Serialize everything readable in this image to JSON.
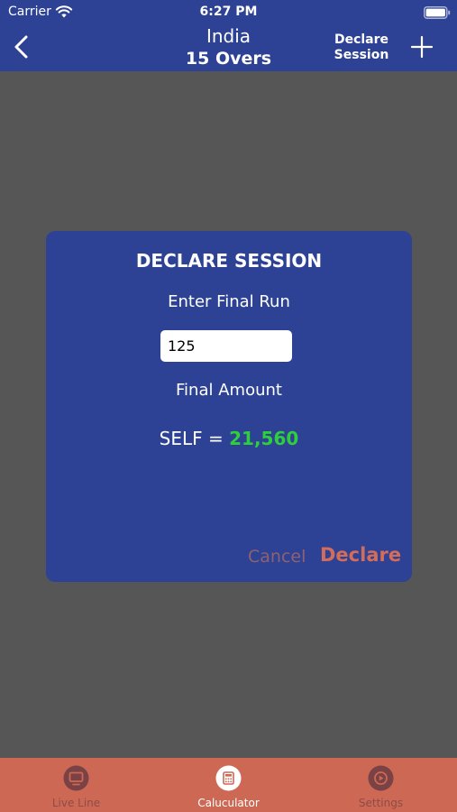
{
  "status_bar": {
    "carrier": "Carrier",
    "time": "6:27 PM"
  },
  "nav": {
    "title": "India",
    "subtitle": "15 Overs",
    "declare_session_line1": "Declare",
    "declare_session_line2": "Session",
    "back_icon": "chevron-left-icon",
    "add_icon": "plus-icon"
  },
  "dialog": {
    "title": "DECLARE SESSION",
    "final_run_label": "Enter Final Run",
    "final_run_value": "125",
    "final_amount_label": "Final Amount",
    "result_prefix": "SELF = ",
    "result_value": "21,560",
    "cancel_label": "Cancel",
    "declare_label": "Declare"
  },
  "tabs": [
    {
      "label": "Live Line",
      "icon": "monitor-icon",
      "active": false
    },
    {
      "label": "Caluculator",
      "icon": "calculator-icon",
      "active": true
    },
    {
      "label": "Settings",
      "icon": "settings-icon",
      "active": false
    }
  ],
  "colors": {
    "header_bg": "#2d4295",
    "overlay_bg": "#565656",
    "tab_bar_bg": "#cd6855",
    "result_green": "#2ecf3b",
    "declare_orange": "#d26c5b",
    "cancel_muted": "#8e6170"
  }
}
